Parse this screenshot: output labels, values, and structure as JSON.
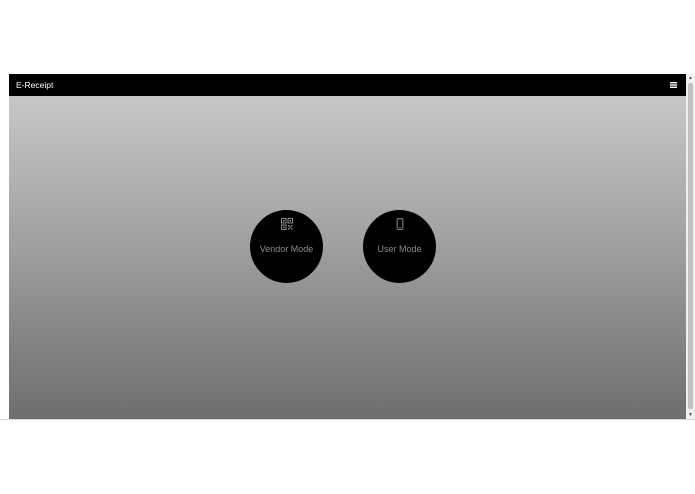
{
  "navbar": {
    "brand": "E-Receipt",
    "menu_icon": "hamburger-menu-icon"
  },
  "modes": [
    {
      "label": "Vendor Mode",
      "icon": "qr-code-icon"
    },
    {
      "label": "User Mode",
      "icon": "mobile-phone-icon"
    }
  ],
  "colors": {
    "navbar_bg": "#000000",
    "gradient_top": "#cdcdcd",
    "gradient_bottom": "#6e6e6e",
    "button_bg": "#000000",
    "button_label": "#8a8a8a"
  }
}
